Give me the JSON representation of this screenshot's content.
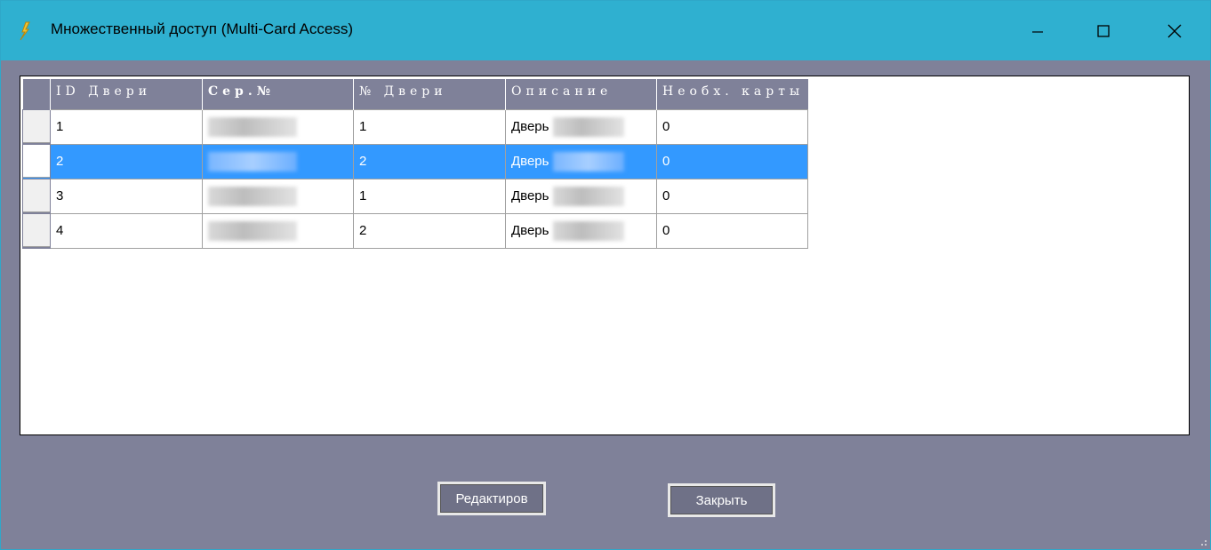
{
  "window": {
    "title": "Множественный доступ (Multi-Card Access)",
    "icons": {
      "app": "keys-icon",
      "minimize": "minimize-icon",
      "maximize": "maximize-icon",
      "close": "close-icon"
    }
  },
  "grid": {
    "columns": [
      "ID Двери",
      "Сер.№",
      "№ Двери",
      "Описание",
      "Необх. карты"
    ],
    "rows": [
      {
        "id": "1",
        "door_no": "1",
        "desc_prefix": "Дверь",
        "required": "0"
      },
      {
        "id": "2",
        "door_no": "2",
        "desc_prefix": "Дверь",
        "required": "0"
      },
      {
        "id": "3",
        "door_no": "1",
        "desc_prefix": "Дверь",
        "required": "0"
      },
      {
        "id": "4",
        "door_no": "2",
        "desc_prefix": "Дверь",
        "required": "0"
      }
    ],
    "selected_row": 2
  },
  "buttons": {
    "edit": "Редактиров",
    "close": "Закрыть"
  },
  "colors": {
    "titlebar": "#2fb0d0",
    "body": "#7f8199",
    "selection": "#3399ff"
  }
}
